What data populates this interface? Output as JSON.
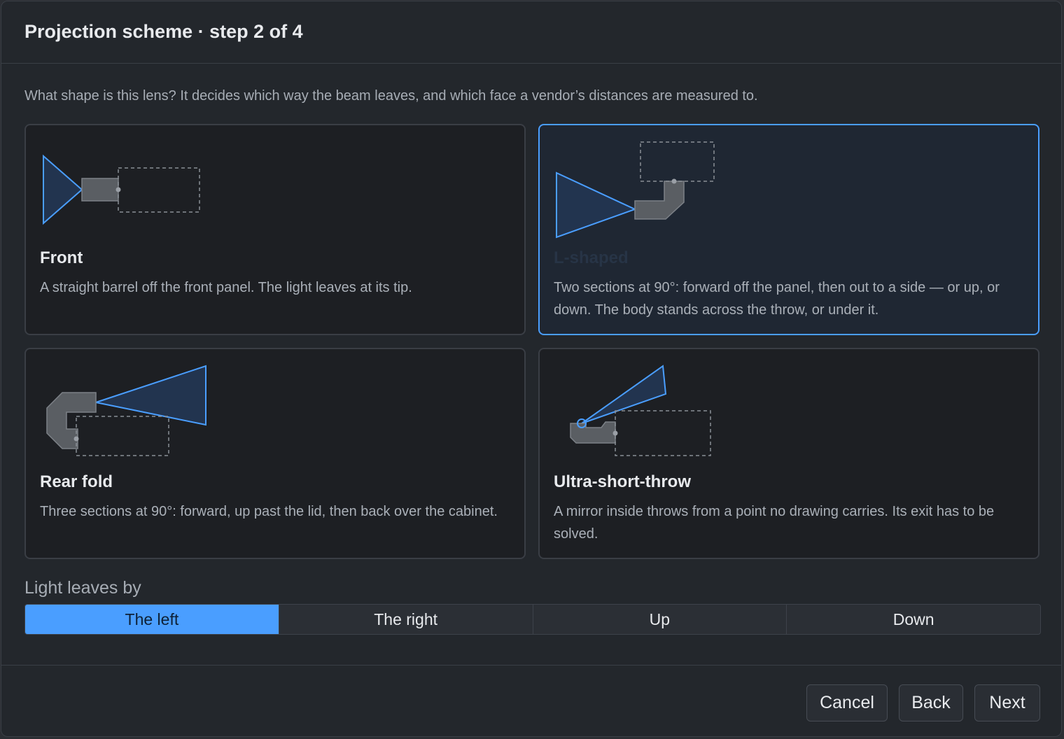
{
  "dialog": {
    "title": "Projection scheme · step 2 of 4",
    "prompt": "What shape is this lens? It decides which way the beam leaves, and which face a vendor’s distances are measured to."
  },
  "options": [
    {
      "title": "Front",
      "description": "A straight barrel off the front panel. The light leaves at its tip.",
      "selected": false
    },
    {
      "title": "L-shaped",
      "description": "Two sections at 90°: forward off the panel, then out to a side — or up, or down. The body stands across the throw, or under it.",
      "selected": true
    },
    {
      "title": "Rear fold",
      "description": "Three sections at 90°: forward, up past the lid, then back over the cabinet.",
      "selected": false
    },
    {
      "title": "Ultra-short-throw",
      "description": "A mirror inside throws from a point no drawing carries. Its exit has to be solved.",
      "selected": false
    }
  ],
  "direction": {
    "label": "Light leaves by",
    "options": [
      "The left",
      "The right",
      "Up",
      "Down"
    ],
    "selected": "The left"
  },
  "footer": {
    "cancel": "Cancel",
    "back": "Back",
    "next": "Next"
  },
  "colors": {
    "accent": "#4a9eff",
    "beam_fill": "#22344f",
    "lens_fill": "#5a5e63"
  }
}
